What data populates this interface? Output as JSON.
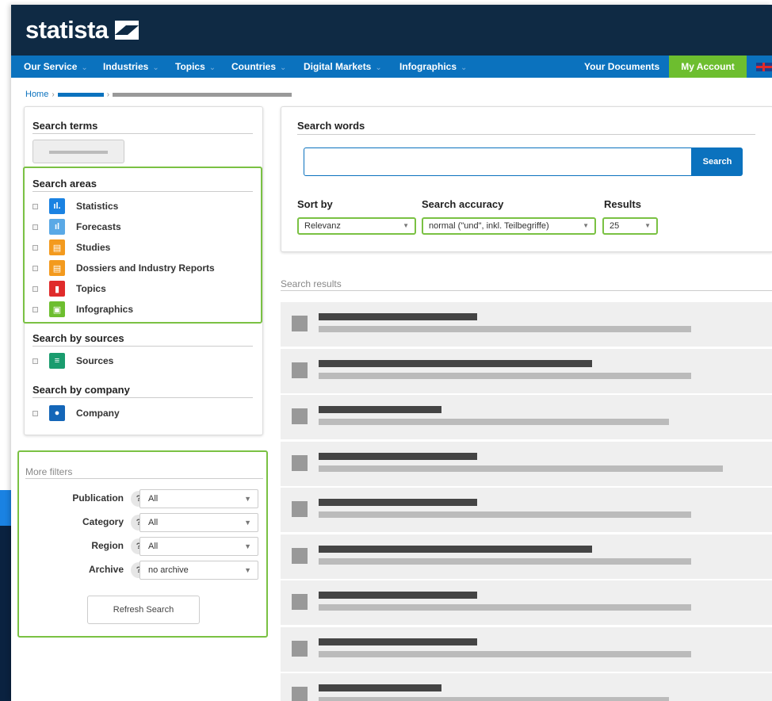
{
  "brand": {
    "name": "statista"
  },
  "nav": {
    "items": [
      {
        "label": "Our Service"
      },
      {
        "label": "Industries"
      },
      {
        "label": "Topics"
      },
      {
        "label": "Countries"
      },
      {
        "label": "Digital Markets"
      },
      {
        "label": "Infographics"
      }
    ],
    "documents_label": "Your Documents",
    "account_label": "My Account",
    "caret": "⌄"
  },
  "breadcrumb": {
    "home": "Home"
  },
  "left": {
    "search_terms_title": "Search  terms",
    "search_areas_title": "Search areas",
    "areas": [
      {
        "label": "Statistics",
        "icon": "bar-chart-icon",
        "color": "#1a82e2",
        "glyph": "ıl."
      },
      {
        "label": "Forecasts",
        "icon": "forecast-chart-icon",
        "color": "#5aa9e6",
        "glyph": "ıl"
      },
      {
        "label": "Studies",
        "icon": "study-document-icon",
        "color": "#f39a1e",
        "glyph": "▤"
      },
      {
        "label": "Dossiers and Industry Reports",
        "icon": "dossier-document-icon",
        "color": "#f39a1e",
        "glyph": "▤"
      },
      {
        "label": "Topics",
        "icon": "topic-page-icon",
        "color": "#e02b2b",
        "glyph": "▮"
      },
      {
        "label": "Infographics",
        "icon": "infographic-icon",
        "color": "#6dbe2f",
        "glyph": "▣"
      }
    ],
    "sources_title": "Search by sources",
    "sources_label": "Sources",
    "sources_icon": "database-icon",
    "sources_color": "#1a9c6e",
    "company_title": "Search by company",
    "company_label": "Company",
    "company_icon": "company-person-icon",
    "company_color": "#1466b8"
  },
  "more_filters": {
    "title": "More filters",
    "filters": [
      {
        "label": "Publication",
        "value": "All"
      },
      {
        "label": "Category",
        "value": "All"
      },
      {
        "label": "Region",
        "value": "All"
      },
      {
        "label": "Archive",
        "value": "no archive"
      }
    ],
    "help": "?",
    "refresh_label": "Refresh Search"
  },
  "search": {
    "title": "Search words",
    "button_label": "Search",
    "sort_label": "Sort by",
    "sort_value": "Relevanz",
    "accuracy_label": "Search accuracy",
    "accuracy_value": "normal (\"und\", inkl. Teilbegriffe)",
    "results_label": "Results",
    "results_value": "25"
  },
  "results": {
    "title": "Search results",
    "rows": [
      {
        "dark": 200,
        "light": 470
      },
      {
        "dark": 345,
        "light": 470
      },
      {
        "dark": 155,
        "light": 442
      },
      {
        "dark": 200,
        "light": 510
      },
      {
        "dark": 200,
        "light": 470
      },
      {
        "dark": 345,
        "light": 470
      },
      {
        "dark": 200,
        "light": 470
      },
      {
        "dark": 200,
        "light": 470
      },
      {
        "dark": 155,
        "light": 442
      }
    ]
  },
  "colors": {
    "header": "#0f2a44",
    "nav": "#0b72be",
    "account": "#6dbe2f",
    "highlight": "#7ac143"
  }
}
